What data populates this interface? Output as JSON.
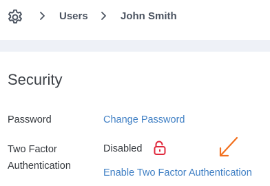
{
  "breadcrumb": {
    "icon": "gear-icon",
    "items": [
      "Users",
      "John Smith"
    ],
    "separator_icon": "chevron-right-icon"
  },
  "security": {
    "title": "Security",
    "password": {
      "label": "Password",
      "action": "Change Password"
    },
    "two_factor": {
      "label_line1": "Two Factor",
      "label_line2": "Authentication",
      "status": "Disabled",
      "status_icon": "unlocked-icon",
      "action": "Enable Two Factor Authentication"
    }
  },
  "annotation": {
    "icon": "arrow-annotation-icon"
  },
  "colors": {
    "link": "#3f7fc4",
    "lock": "#e0283c",
    "annotation_arrow": "#f2701e",
    "band": "#eef1f7"
  }
}
